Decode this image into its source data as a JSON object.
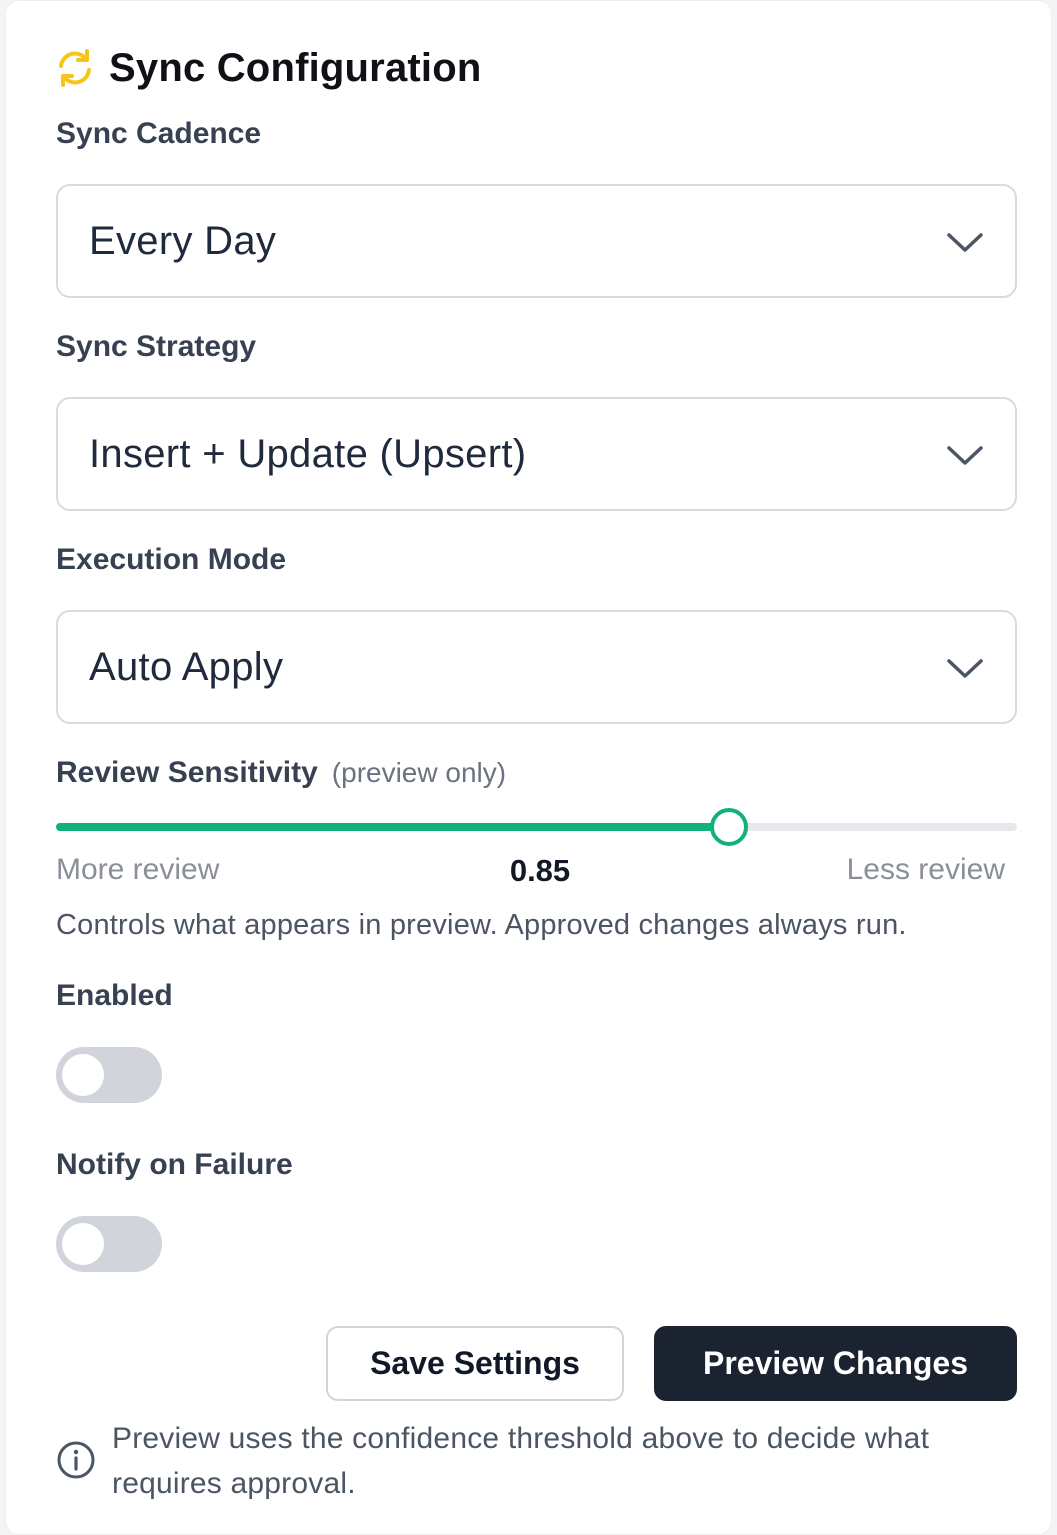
{
  "header": {
    "title": "Sync Configuration",
    "icon": "refresh-icon",
    "icon_color": "#f5c518"
  },
  "cadence": {
    "label": "Sync Cadence",
    "value": "Every Day"
  },
  "strategy": {
    "label": "Sync Strategy",
    "value": "Insert + Update (Upsert)"
  },
  "mode": {
    "label": "Execution Mode",
    "value": "Auto Apply"
  },
  "sensitivity": {
    "label": "Review Sensitivity",
    "sub": "(preview only)",
    "fraction": 0.7,
    "value_text": "0.85",
    "min_label": "More review",
    "max_label": "Less review",
    "help": "Controls what appears in preview. Approved changes always run.",
    "accent": "#10b27a"
  },
  "enabled": {
    "label": "Enabled",
    "on": false
  },
  "notify": {
    "label": "Notify on Failure",
    "on": false
  },
  "actions": {
    "save_label": "Save Settings",
    "preview_label": "Preview Changes"
  },
  "footer": {
    "icon": "info-icon",
    "note": "Preview uses the confidence threshold above to decide what requires approval."
  }
}
